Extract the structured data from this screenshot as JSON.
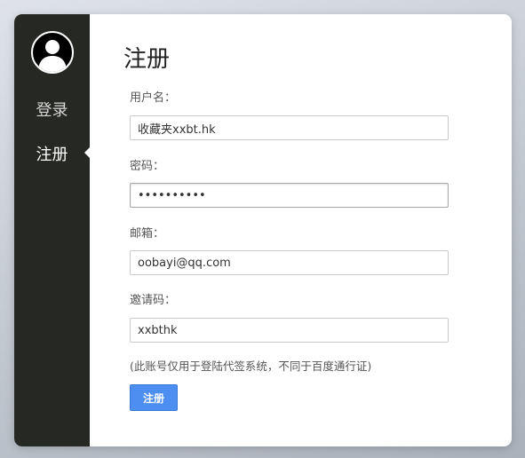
{
  "sidebar": {
    "avatar_icon": "user-avatar-icon",
    "items": [
      {
        "label": "登录",
        "active": false
      },
      {
        "label": "注册",
        "active": true
      }
    ]
  },
  "form": {
    "title": "注册",
    "fields": [
      {
        "label": "用户名：",
        "value": "收藏夹xxbt.hk",
        "type": "text"
      },
      {
        "label": "密码：",
        "value": "••••••••••",
        "type": "password"
      },
      {
        "label": "邮箱：",
        "value": "oobayi@qq.com",
        "type": "text"
      },
      {
        "label": "邀请码：",
        "value": "xxbthk",
        "type": "text"
      }
    ],
    "note": "(此账号仅用于登陆代签系统，不同于百度通行证)",
    "submit_label": "注册"
  },
  "colors": {
    "sidebar_bg": "#262823",
    "button_bg": "#4d8ff0"
  }
}
